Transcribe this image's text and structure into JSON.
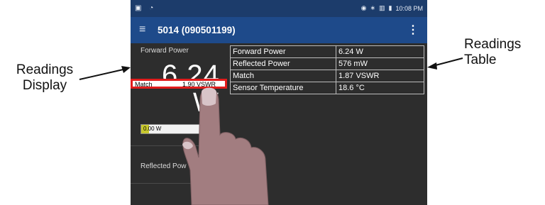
{
  "annotations": {
    "readings_display": "Readings\nDisplay",
    "readings_table": "Readings\nTable"
  },
  "statusbar": {
    "time": "10:08 PM"
  },
  "appbar": {
    "title": "5014 (090501199)"
  },
  "display": {
    "forward_label": "Forward Power",
    "big_value": "6.24",
    "unit": "W",
    "match_label": "Match",
    "match_value": "1.90 VSWR",
    "bar_min": "0.00 W",
    "bar_max": "50",
    "bar_fill_fraction": 0.1,
    "reflected_label": "Reflected Pow"
  },
  "table": {
    "rows": [
      {
        "label": "Forward Power",
        "value": "6.24 W"
      },
      {
        "label": "Reflected Power",
        "value": "576 mW"
      },
      {
        "label": "Match",
        "value": "1.87 VSWR"
      },
      {
        "label": "Sensor Temperature",
        "value": "18.6 °C"
      }
    ]
  },
  "colors": {
    "statusbar": "#1c3c6b",
    "appbar": "#1e4a8a",
    "background": "#2d2d2d",
    "highlight": "#e11c1c",
    "bar_fill": "#c9c92e",
    "finger": "#a27d80"
  }
}
